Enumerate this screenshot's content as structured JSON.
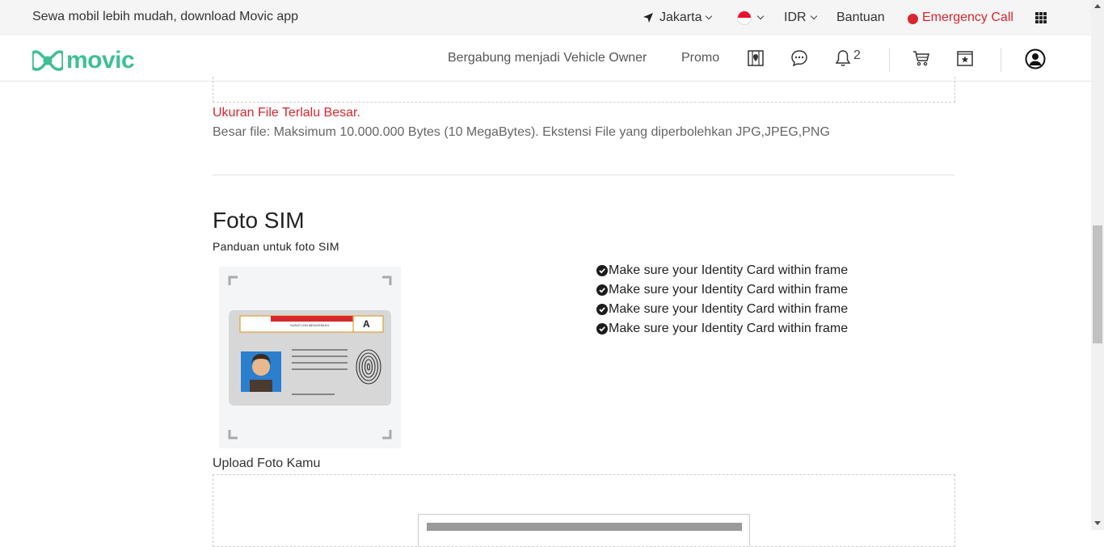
{
  "topbar": {
    "promo_text": "Sewa mobil lebih mudah, download Movic app",
    "location": "Jakarta",
    "currency": "IDR",
    "help": "Bantuan",
    "emergency": "Emergency Call"
  },
  "nav": {
    "logo_text": "movic",
    "join_owner": "Bergabung menjadi Vehicle Owner",
    "promo": "Promo",
    "notification_count": "2"
  },
  "upload_prev": {
    "error": "Ukuran File Terlalu Besar.",
    "hint": "Besar file: Maksimum 10.000.000 Bytes (10 MegaBytes). Ekstensi File yang diperbolehkan JPG,JPEG,PNG"
  },
  "sim_section": {
    "title": "Foto SIM",
    "guide_label": "Panduan untuk foto SIM",
    "card_title": "SURAT IZIN MENGEMUDI",
    "card_class": "A",
    "checklist": [
      "Make sure your Identity Card within frame",
      "Make sure your Identity Card within frame",
      "Make sure your Identity Card within frame",
      "Make sure your Identity Card within frame"
    ],
    "upload_label": "Upload Foto Kamu"
  },
  "colors": {
    "brand": "#3fbf95",
    "error": "#d9262f"
  }
}
